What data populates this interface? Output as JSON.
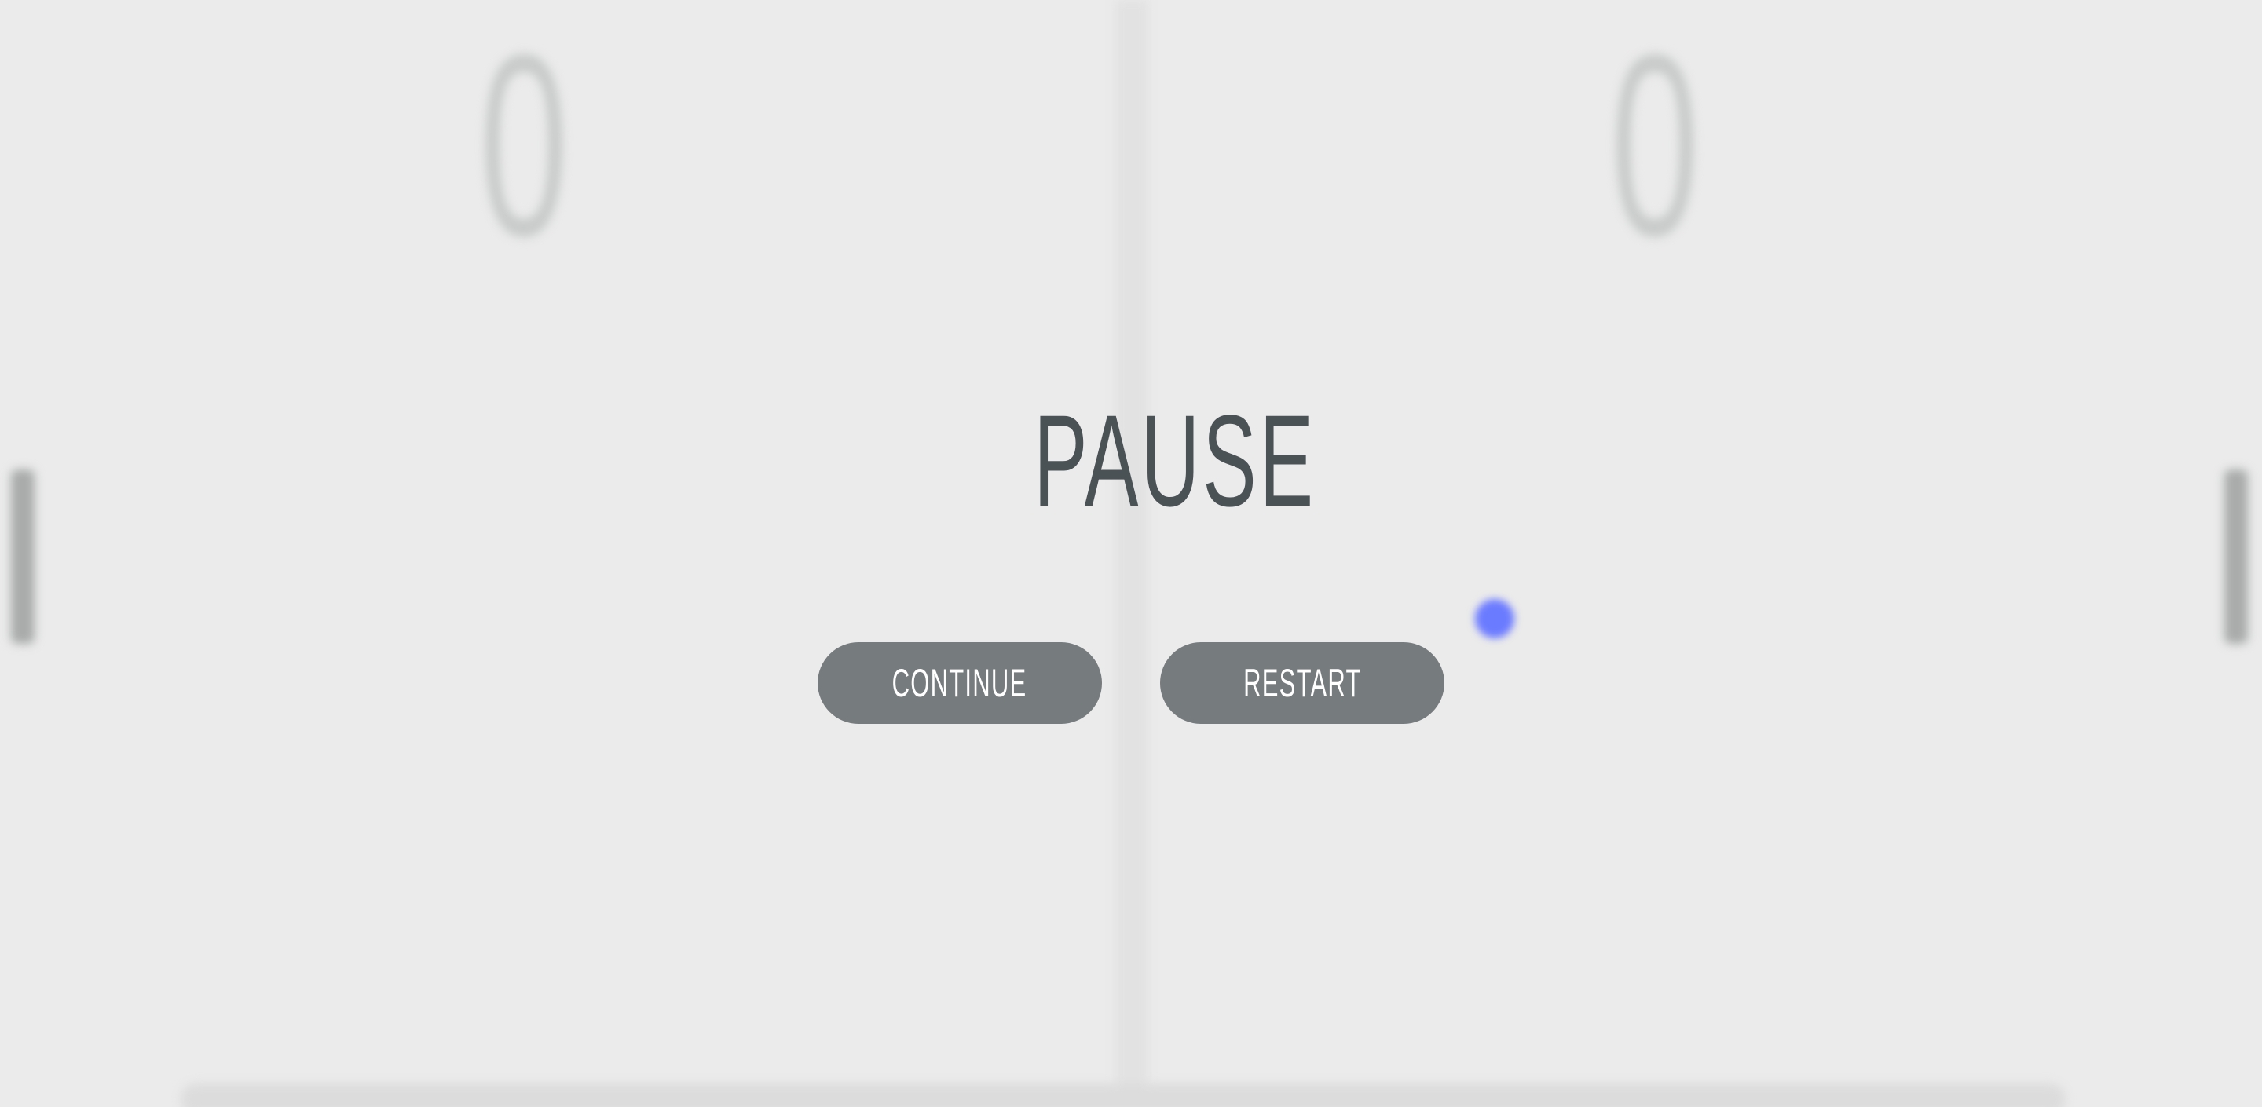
{
  "game": {
    "scores": {
      "left": "0",
      "right": "0"
    },
    "ball_color": "#6b7bff",
    "paddle_color": "#a9abab"
  },
  "pause_menu": {
    "title": "PAUSE",
    "continue_label": "CONTINUE",
    "restart_label": "RESTART",
    "button_color": "#767b7e",
    "title_color": "#4b5256"
  }
}
